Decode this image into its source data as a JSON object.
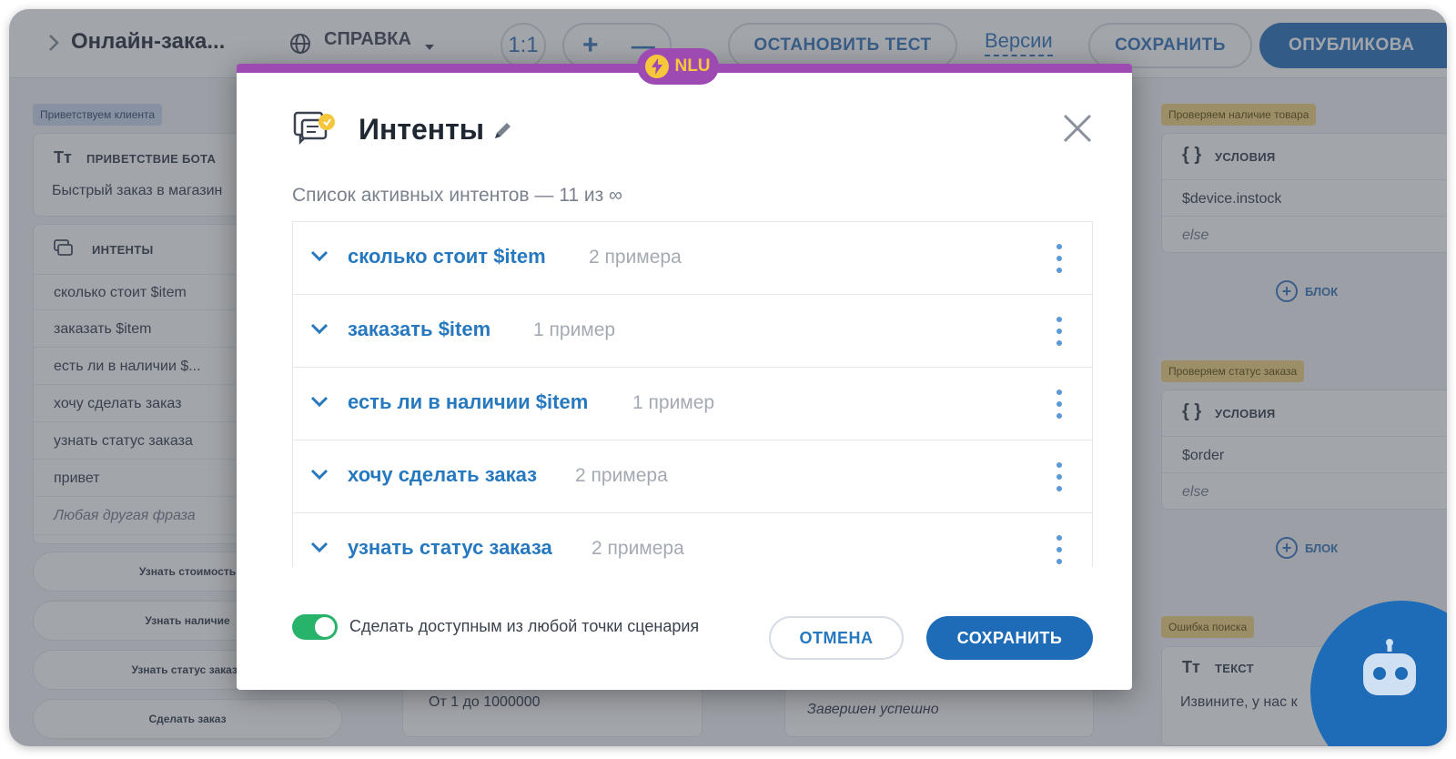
{
  "topbar": {
    "back_icon": "chevron-right-icon",
    "project_title": "Онлайн-зака...",
    "help_label": "СПРАВКА",
    "zoom_reset": "1:1",
    "zoom_in": "+",
    "zoom_out": "—",
    "stop_test": "ОСТАНОВИТЬ ТЕСТ",
    "versions": "Версии",
    "save": "СОХРАНИТЬ",
    "publish": "ОПУБЛИКОВА"
  },
  "canvas": {
    "left": {
      "tag": "Приветствуем клиента",
      "greeting_head": "ПРИВЕТСТВИЕ БОТА",
      "greeting_text": "Быстрый заказ в магазин",
      "intents_head": "ИНТЕНТЫ",
      "intents": [
        "сколько стоит $item",
        "заказать $item",
        "есть ли в наличии $...",
        "хочу сделать заказ",
        "узнать статус заказа",
        "привет"
      ],
      "fallback": "Любая другая фраза",
      "buttons": [
        "Узнать стоимость",
        "Узнать наличие",
        "Узнать статус заказа",
        "Сделать заказ"
      ]
    },
    "center_bottom": {
      "range_text": "От 1 до 1000000",
      "done_text": "Завершен успешно"
    },
    "right": {
      "block1_tag": "Проверяем наличие товара",
      "block1_head": "УСЛОВИЯ",
      "block1_rows": [
        "$device.instock",
        "else"
      ],
      "block2_tag": "Проверяем статус заказа",
      "block2_head": "УСЛОВИЯ",
      "block2_rows": [
        "$order",
        "else"
      ],
      "block3_tag": "Ошибка поиска",
      "block3_head": "ТЕКСТ",
      "block3_text": "Извините, у нас к",
      "add_block": "БЛОК"
    }
  },
  "modal": {
    "badge": "NLU",
    "title": "Интенты",
    "subtitle": "Список активных интентов — 11 из ∞",
    "intents": [
      {
        "name": "сколько стоит $item",
        "count": "2 примера"
      },
      {
        "name": "заказать $item",
        "count": "1 пример"
      },
      {
        "name": "есть ли в наличии $item",
        "count": "1 пример"
      },
      {
        "name": "хочу сделать заказ",
        "count": "2 примера"
      },
      {
        "name": "узнать статус заказа",
        "count": "2 примера"
      }
    ],
    "toggle_on": true,
    "toggle_label": "Сделать доступным из любой точки сценария",
    "cancel": "ОТМЕНА",
    "save": "СОХРАНИТЬ"
  },
  "colors": {
    "accent": "#1e6bb8",
    "link": "#2678bf",
    "nlu_purple": "#9d4bb3",
    "nlu_yellow": "#f6c73a",
    "toggle_green": "#28b36b"
  }
}
